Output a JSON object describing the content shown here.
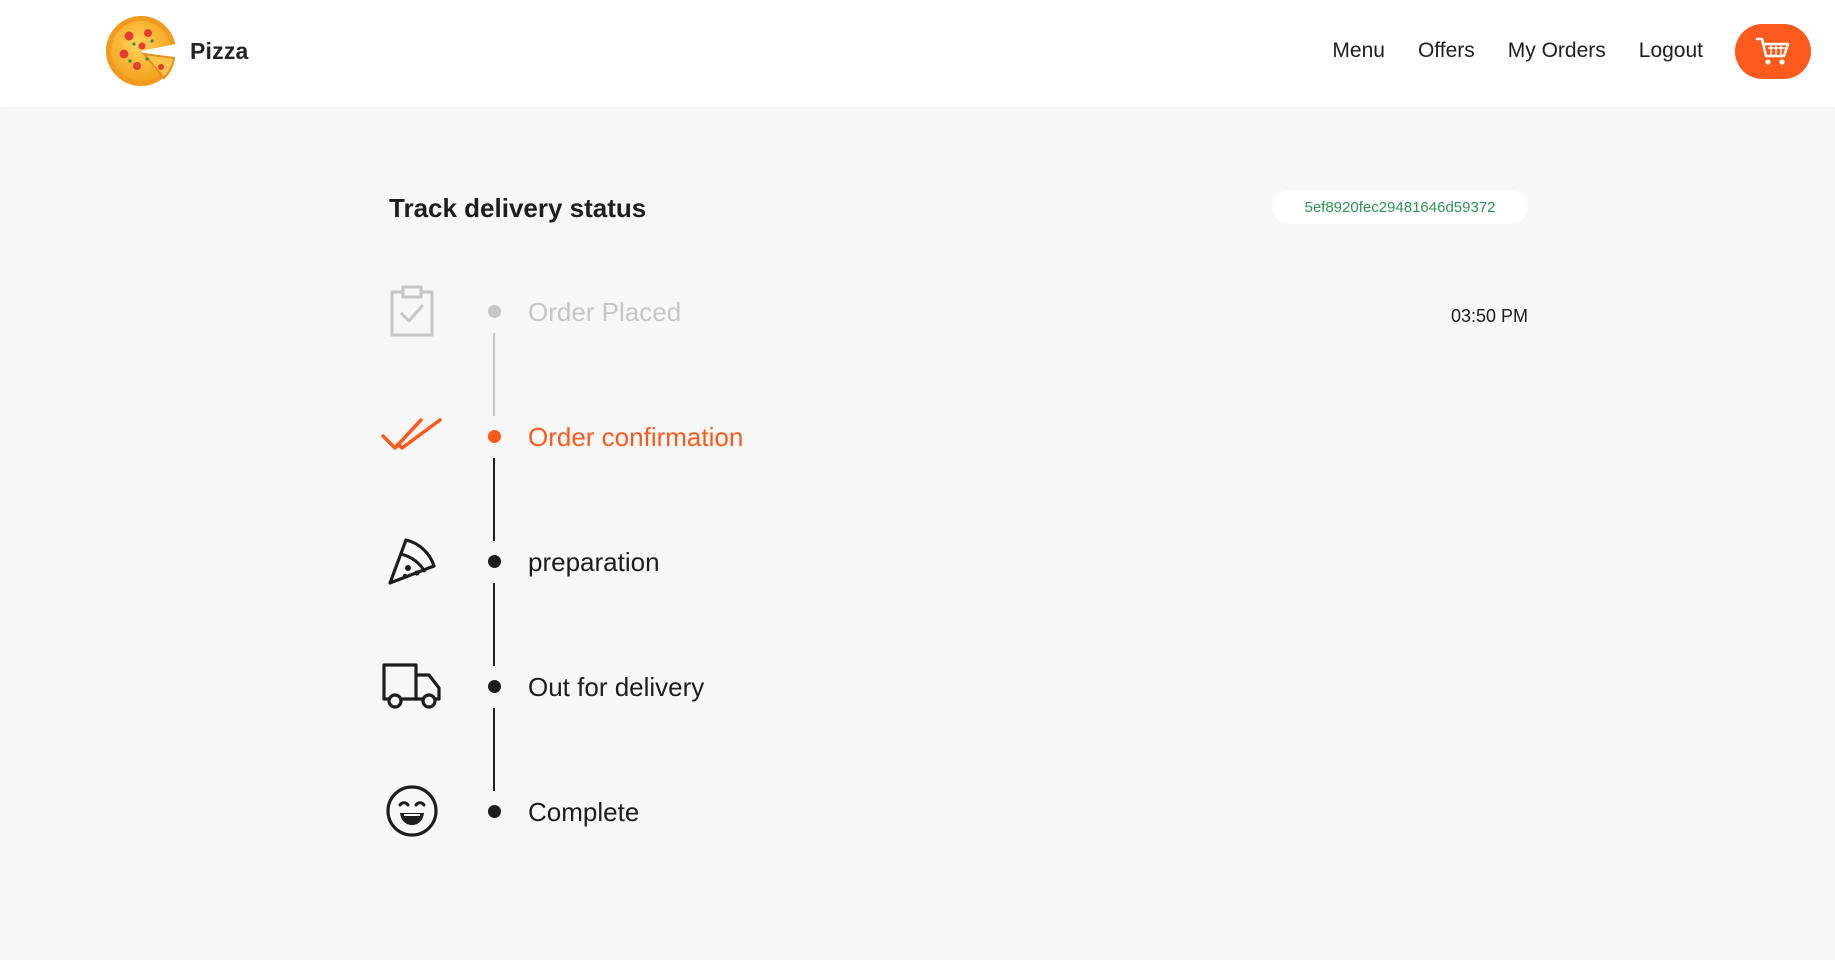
{
  "brand": {
    "name": "Pizza",
    "logo_icon": "pizza-logo-icon"
  },
  "nav": {
    "items": [
      {
        "label": "Menu"
      },
      {
        "label": "Offers"
      },
      {
        "label": "My Orders"
      },
      {
        "label": "Logout"
      }
    ],
    "cart_icon": "cart-icon"
  },
  "tracking": {
    "title": "Track delivery status",
    "order_id": "5ef8920fec29481646d59372",
    "timestamp": "03:50 PM",
    "steps": [
      {
        "label": "Order Placed",
        "icon": "clipboard-check-icon",
        "state": "completed"
      },
      {
        "label": "Order confirmation",
        "icon": "double-check-icon",
        "state": "current"
      },
      {
        "label": "preparation",
        "icon": "pizza-slice-icon",
        "state": "pending"
      },
      {
        "label": "Out for delivery",
        "icon": "delivery-truck-icon",
        "state": "pending"
      },
      {
        "label": "Complete",
        "icon": "smiley-face-icon",
        "state": "pending"
      }
    ]
  },
  "colors": {
    "accent": "#fe5a1d",
    "completed": "#c7c7c7",
    "pending": "#1d1d1d",
    "order_id_text": "#2e9355",
    "background": "#f7f7f8"
  }
}
